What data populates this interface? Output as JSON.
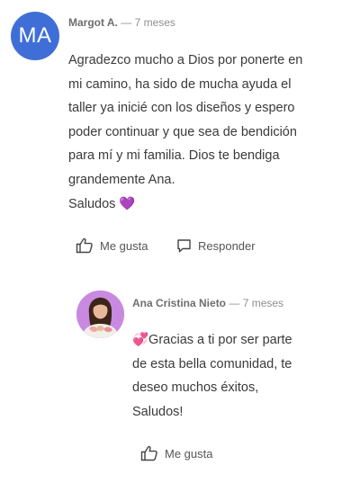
{
  "comment": {
    "avatar_initials": "MA",
    "author": "Margot A.",
    "time": "— 7 meses",
    "text": "Agradezco mucho a Dios por ponerte en\nmi camino, ha sido de mucha ayuda el\ntaller ya inicié con los diseños y espero\npoder continuar y que sea de bendición\npara mí y mi familia.  Dios te bendiga\ngrandemente Ana.\nSaludos 💜",
    "like_label": "Me gusta",
    "reply_label": "Responder"
  },
  "reply": {
    "author": "Ana Cristina Nieto",
    "time": "— 7 meses",
    "text": "💞Gracias a ti por ser parte\nde esta bella comunidad, te\ndeseo muchos éxitos,\nSaludos!",
    "like_label": "Me gusta"
  },
  "colors": {
    "avatar_bg": "#3f6fd6",
    "reply_avatar_bg": "#c88ae0"
  },
  "icons": {
    "like": "thumbs-up-icon",
    "reply": "speech-bubble-icon"
  }
}
